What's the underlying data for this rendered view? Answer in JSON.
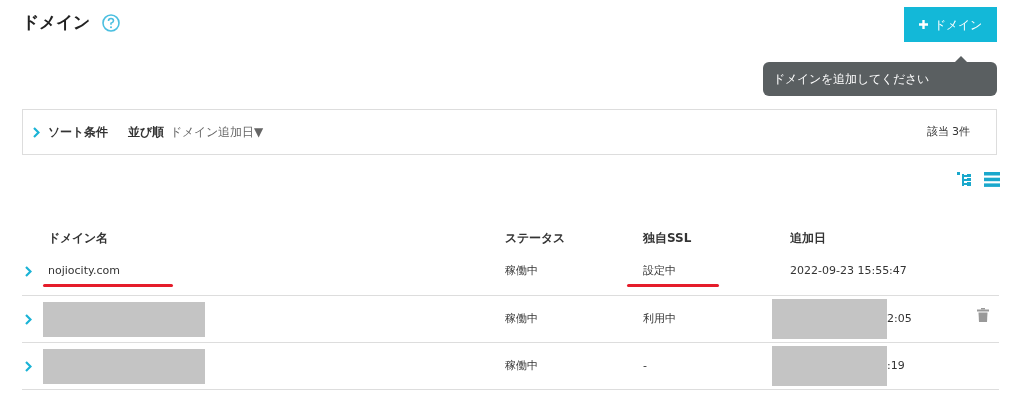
{
  "page": {
    "title": "ドメイン"
  },
  "add_button": {
    "label": "ドメイン"
  },
  "tooltip": {
    "text": "ドメインを追加してください"
  },
  "sort": {
    "title": "ソート条件",
    "order_label": "並び順",
    "order_value": "ドメイン追加日",
    "caret": "▼",
    "count": "該当 3件"
  },
  "table": {
    "columns": [
      "ドメイン名",
      "ステータス",
      "独自SSL",
      "追加日"
    ],
    "rows": [
      {
        "name": "nojiocity.com",
        "name_redacted": false,
        "name_marked": true,
        "status": "稼働中",
        "ssl": "設定中",
        "ssl_marked": true,
        "date": "2022-09-23 15:55:47",
        "date_redacted": false,
        "trash_shown": false
      },
      {
        "name_redacted": true,
        "name_marked": false,
        "status": "稼働中",
        "ssl": "利用中",
        "ssl_marked": false,
        "date": "2:05",
        "date_redacted": true,
        "trash_shown": true
      },
      {
        "name_redacted": true,
        "name_marked": false,
        "status": "稼働中",
        "ssl": "-",
        "ssl_marked": false,
        "date": ":19",
        "date_redacted": true,
        "trash_shown": false
      }
    ]
  }
}
